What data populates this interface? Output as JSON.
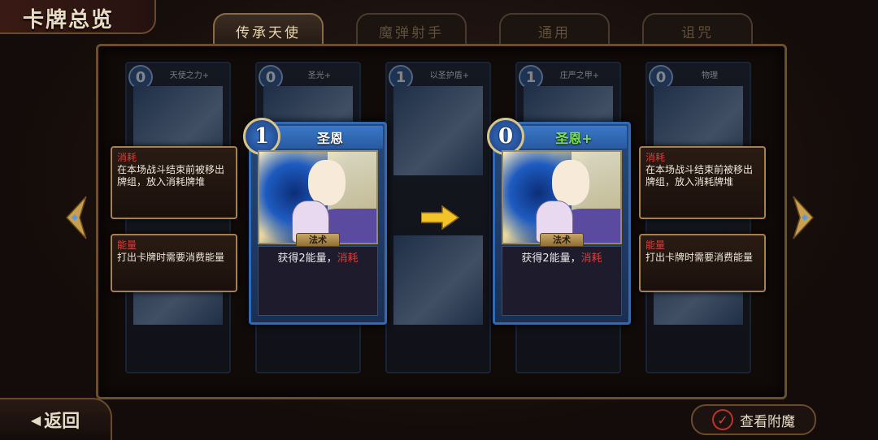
{
  "title": "卡牌总览",
  "tabs": [
    {
      "label": "传承天使",
      "active": true
    },
    {
      "label": "魔弹射手",
      "active": false
    },
    {
      "label": "通用",
      "active": false
    },
    {
      "label": "诅咒",
      "active": false
    }
  ],
  "card_original": {
    "cost": "1",
    "name": "圣恩",
    "type": "法术",
    "desc_prefix": "获得2能量，",
    "desc_keyword": "消耗"
  },
  "card_upgraded": {
    "cost": "0",
    "name": "圣恩+",
    "type": "法术",
    "desc_prefix": "获得2能量，",
    "desc_keyword": "消耗"
  },
  "tooltips": {
    "exhaust_title": "消耗",
    "exhaust_body": "在本场战斗结束前被移出牌组，放入消耗牌堆",
    "energy_title": "能量",
    "energy_body": "打出卡牌时需要消费能量"
  },
  "background_cards": [
    {
      "cost": "0",
      "name": "天使之力+"
    },
    {
      "cost": "0",
      "name": "圣光+"
    },
    {
      "cost": "1",
      "name": "以圣护盾+"
    },
    {
      "cost": "1",
      "name": "庄严之甲+"
    },
    {
      "cost": "0",
      "name": "物理"
    }
  ],
  "back_button": "返回",
  "view_button": "查看附魔",
  "colors": {
    "accent_gold": "#a88050",
    "card_blue": "#2f6ab8",
    "keyword_red": "#e03a3a",
    "upgraded_green": "#7ee05a"
  }
}
